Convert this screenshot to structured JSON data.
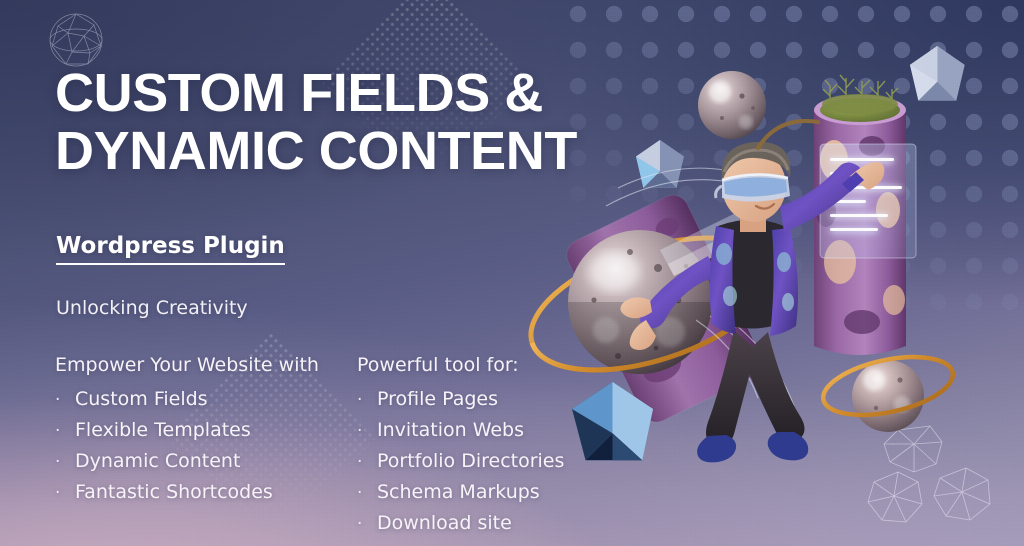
{
  "banner": {
    "headline": "CUSTOM FIELDS &\nDYNAMIC CONTENT",
    "plugin_label": "Wordpress Plugin",
    "tagline": "Unlocking Creativity",
    "columns": [
      {
        "heading": "Empower Your Website with",
        "bullet_glyph": "·",
        "items": [
          "Custom Fields",
          "Flexible Templates",
          "Dynamic Content",
          "Fantastic Shortcodes"
        ]
      },
      {
        "heading": "Powerful tool for:",
        "bullet_glyph": "·",
        "items": [
          "Profile Pages",
          "Invitation Webs",
          "Portfolio Directories",
          "Schema Markups",
          "Download site"
        ]
      }
    ]
  },
  "illustration": {
    "alt": "3D character wearing VR goggles floating among metallic spheres, faceted icosahedrons, purple columns and a glowing UI panel",
    "elements": [
      "vr-character",
      "metallic-sphere-large",
      "metallic-sphere-top",
      "metallic-sphere-small",
      "gold-ring",
      "icosahedron-blue-large",
      "icosahedron-blue-small",
      "icosahedron-grey-top",
      "purple-column-left",
      "purple-column-right",
      "floating-island",
      "glow-ui-panel"
    ]
  },
  "decor": {
    "polka_dots": "top-right circle field",
    "halftone_diamond_top": "behind headline",
    "halftone_diamond_bottom": "behind left bullet list",
    "wireframe_sphere": "top-left",
    "wireframe_rocks": "bottom-right"
  },
  "colors": {
    "bg_dark_slate": "#3f4568",
    "bg_navy": "#3a4370",
    "bg_mauve": "#c3aec0",
    "bg_pink": "#d6b6c6",
    "text_white": "#ffffff",
    "accent_gold": "#d99b3c",
    "accent_blue": "#5b8fd0",
    "accent_purple": "#8a5ba0"
  }
}
